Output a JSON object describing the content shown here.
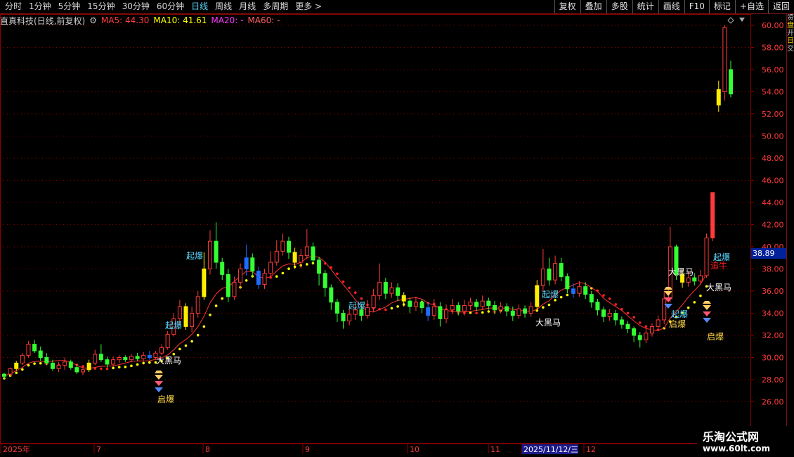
{
  "toolbar": {
    "periods": [
      "分时",
      "1分钟",
      "5分钟",
      "15分钟",
      "30分钟",
      "60分钟",
      "日线",
      "周线",
      "月线",
      "多周期",
      "更多 >"
    ],
    "active_period": "日线",
    "tools": [
      "复权",
      "叠加",
      "多股",
      "统计",
      "画线",
      "F10",
      "标记",
      "+自选",
      "返回"
    ]
  },
  "info": {
    "stock": "直真科技(日线,前复权)",
    "ma5": "MA5: 44.30",
    "ma10": "MA10: 41.61",
    "ma20": "MA20: -",
    "ma60": "MA60: -"
  },
  "y_axis": {
    "ticks": [
      "60.00",
      "58.00",
      "56.00",
      "54.00",
      "52.00",
      "50.00",
      "48.00",
      "46.00",
      "44.00",
      "42.00",
      "40.00",
      "38.00",
      "36.00",
      "34.00",
      "32.00",
      "30.00",
      "28.00",
      "26.00"
    ],
    "current_price": "38.89"
  },
  "x_axis": {
    "labels": [
      "2025年",
      "7",
      "8",
      "9",
      "10",
      "11",
      "2025/11/12/三",
      "12"
    ]
  },
  "right_edge": {
    "text_1": "资金流向资金流向",
    "tag_1": "盘",
    "text_2": "开盘涨跌幅",
    "tag_2": "日",
    "text_3": "交易"
  },
  "signals": {
    "qibao": "起爆",
    "dahei": "大黑马",
    "qibao2": "启爆",
    "zhuiniu": "追牛"
  },
  "watermark": {
    "title": "乐淘公式网",
    "url": "www.60lt.com"
  },
  "colors": {
    "up": "#ff3a3a",
    "down": "#33ff33",
    "signal_bar": "#ffee00",
    "blue_bar": "#1e6bff",
    "ma_dots": "#ffff00",
    "red_dots": "#ff2020",
    "grid": "#8b0000"
  },
  "chart_data": {
    "type": "candlestick",
    "ylim": [
      25,
      61
    ],
    "bars": [
      [
        28.3,
        28.5,
        28.0,
        28.6,
        "d"
      ],
      [
        28.5,
        29.0,
        28.3,
        29.1,
        "u"
      ],
      [
        29.0,
        29.5,
        28.8,
        29.7,
        "u"
      ],
      [
        29.5,
        30.2,
        29.3,
        30.4,
        "u"
      ],
      [
        30.2,
        31.2,
        30.0,
        31.5,
        "u"
      ],
      [
        31.2,
        30.6,
        30.4,
        31.6,
        "d"
      ],
      [
        30.6,
        30.0,
        29.7,
        31.0,
        "d"
      ],
      [
        30.0,
        29.5,
        29.3,
        30.4,
        "d"
      ],
      [
        29.5,
        29.0,
        28.8,
        29.8,
        "d"
      ],
      [
        29.0,
        29.3,
        28.7,
        29.6,
        "u"
      ],
      [
        29.3,
        29.6,
        28.9,
        30.0,
        "u"
      ],
      [
        29.6,
        29.1,
        28.9,
        29.8,
        "d"
      ],
      [
        29.1,
        28.7,
        28.5,
        29.4,
        "d"
      ],
      [
        28.7,
        28.9,
        28.4,
        29.2,
        "u"
      ],
      [
        28.9,
        29.5,
        28.7,
        29.8,
        "u"
      ],
      [
        29.5,
        30.3,
        29.3,
        30.7,
        "u"
      ],
      [
        30.3,
        29.8,
        29.6,
        31.2,
        "d"
      ],
      [
        29.8,
        29.4,
        29.1,
        30.1,
        "d"
      ],
      [
        29.4,
        29.8,
        29.2,
        30.1,
        "u"
      ],
      [
        29.8,
        30.0,
        29.5,
        30.2,
        "u"
      ],
      [
        30.0,
        29.8,
        29.6,
        30.2,
        "d"
      ],
      [
        29.8,
        30.1,
        29.6,
        30.3,
        "u"
      ],
      [
        30.1,
        29.9,
        29.7,
        30.4,
        "d"
      ],
      [
        29.9,
        30.2,
        29.7,
        30.5,
        "u"
      ],
      [
        30.2,
        30.0,
        29.8,
        30.6,
        "d"
      ],
      [
        30.0,
        30.4,
        29.8,
        30.6,
        "u"
      ],
      [
        30.4,
        30.9,
        30.2,
        31.2,
        "u"
      ],
      [
        30.9,
        32.1,
        30.7,
        32.4,
        "u"
      ],
      [
        32.1,
        33.5,
        31.9,
        34.0,
        "u"
      ],
      [
        33.5,
        34.6,
        33.0,
        35.2,
        "u"
      ],
      [
        34.6,
        32.8,
        32.5,
        34.9,
        "d"
      ],
      [
        32.8,
        34.0,
        32.3,
        34.6,
        "u"
      ],
      [
        34.0,
        35.5,
        33.6,
        36.0,
        "u"
      ],
      [
        35.5,
        38.0,
        35.2,
        39.5,
        "u"
      ],
      [
        38.0,
        40.5,
        37.5,
        41.5,
        "u"
      ],
      [
        40.5,
        38.6,
        38.0,
        42.2,
        "d"
      ],
      [
        38.6,
        37.5,
        37.0,
        39.0,
        "d"
      ],
      [
        37.5,
        35.5,
        35.0,
        38.0,
        "d"
      ],
      [
        35.5,
        36.8,
        35.2,
        37.3,
        "u"
      ],
      [
        36.8,
        38.0,
        36.3,
        38.5,
        "u"
      ],
      [
        38.0,
        39.0,
        37.4,
        40.2,
        "u"
      ],
      [
        39.0,
        37.8,
        37.3,
        39.4,
        "d"
      ],
      [
        37.8,
        36.6,
        36.2,
        38.2,
        "d"
      ],
      [
        36.6,
        37.6,
        36.2,
        38.0,
        "u"
      ],
      [
        37.6,
        38.6,
        37.2,
        39.6,
        "u"
      ],
      [
        38.6,
        39.6,
        38.3,
        40.6,
        "u"
      ],
      [
        39.6,
        40.5,
        39.2,
        41.2,
        "u"
      ],
      [
        40.5,
        39.5,
        38.9,
        40.9,
        "d"
      ],
      [
        39.5,
        38.6,
        38.0,
        39.9,
        "d"
      ],
      [
        38.6,
        39.2,
        38.1,
        39.8,
        "u"
      ],
      [
        39.2,
        40.0,
        38.9,
        41.6,
        "u"
      ],
      [
        40.0,
        38.8,
        38.4,
        40.4,
        "d"
      ],
      [
        38.8,
        37.6,
        36.5,
        39.1,
        "d"
      ],
      [
        37.6,
        36.3,
        35.5,
        37.9,
        "d"
      ],
      [
        36.3,
        35.0,
        34.3,
        36.6,
        "d"
      ],
      [
        35.0,
        34.0,
        33.2,
        35.3,
        "d"
      ],
      [
        34.0,
        33.3,
        32.6,
        34.3,
        "d"
      ],
      [
        33.3,
        33.9,
        32.9,
        34.5,
        "u"
      ],
      [
        33.9,
        34.3,
        33.4,
        34.8,
        "u"
      ],
      [
        34.3,
        33.8,
        33.3,
        34.6,
        "d"
      ],
      [
        33.8,
        34.5,
        33.5,
        35.2,
        "u"
      ],
      [
        34.5,
        35.6,
        34.1,
        36.2,
        "u"
      ],
      [
        35.6,
        36.8,
        35.2,
        38.5,
        "u"
      ],
      [
        36.8,
        35.8,
        35.3,
        37.2,
        "d"
      ],
      [
        35.8,
        36.3,
        35.4,
        36.8,
        "u"
      ],
      [
        36.3,
        35.6,
        35.1,
        36.7,
        "d"
      ],
      [
        35.6,
        35.1,
        34.6,
        35.9,
        "d"
      ],
      [
        35.1,
        34.6,
        34.0,
        35.4,
        "d"
      ],
      [
        34.6,
        35.0,
        34.2,
        35.5,
        "u"
      ],
      [
        35.0,
        34.5,
        34.0,
        35.3,
        "d"
      ],
      [
        34.5,
        33.8,
        33.3,
        35.0,
        "d"
      ],
      [
        33.8,
        34.6,
        33.4,
        35.3,
        "u"
      ],
      [
        34.6,
        33.5,
        32.8,
        35.0,
        "d"
      ],
      [
        33.5,
        34.3,
        33.1,
        34.8,
        "u"
      ],
      [
        34.3,
        34.7,
        33.9,
        35.3,
        "u"
      ],
      [
        34.7,
        34.2,
        33.8,
        35.0,
        "d"
      ],
      [
        34.2,
        34.7,
        33.8,
        35.2,
        "u"
      ],
      [
        34.7,
        35.0,
        34.3,
        35.4,
        "u"
      ],
      [
        35.0,
        34.6,
        34.2,
        35.3,
        "d"
      ],
      [
        34.6,
        35.1,
        34.3,
        35.6,
        "u"
      ],
      [
        35.1,
        34.7,
        34.3,
        35.4,
        "d"
      ],
      [
        34.7,
        34.3,
        33.9,
        35.1,
        "d"
      ],
      [
        34.3,
        34.6,
        34.0,
        35.0,
        "u"
      ],
      [
        34.6,
        34.2,
        33.7,
        34.9,
        "d"
      ],
      [
        34.2,
        33.8,
        33.3,
        34.6,
        "d"
      ],
      [
        33.8,
        34.4,
        33.5,
        34.8,
        "u"
      ],
      [
        34.4,
        34.0,
        33.6,
        34.7,
        "d"
      ],
      [
        34.0,
        34.6,
        33.7,
        35.0,
        "u"
      ],
      [
        34.6,
        36.5,
        34.3,
        37.0,
        "u"
      ],
      [
        36.5,
        38.0,
        36.0,
        39.8,
        "u"
      ],
      [
        38.0,
        37.0,
        36.5,
        39.0,
        "d"
      ],
      [
        37.0,
        38.5,
        36.6,
        39.2,
        "u"
      ],
      [
        38.5,
        37.3,
        36.9,
        39.0,
        "d"
      ],
      [
        37.3,
        36.2,
        35.8,
        37.6,
        "d"
      ],
      [
        36.2,
        35.8,
        35.4,
        36.7,
        "d"
      ],
      [
        35.8,
        36.4,
        35.5,
        36.9,
        "u"
      ],
      [
        36.4,
        35.7,
        35.3,
        36.8,
        "d"
      ],
      [
        35.7,
        35.0,
        34.5,
        36.0,
        "d"
      ],
      [
        35.0,
        34.3,
        33.8,
        35.3,
        "d"
      ],
      [
        34.3,
        33.7,
        33.2,
        34.6,
        "d"
      ],
      [
        33.7,
        34.0,
        33.3,
        34.4,
        "u"
      ],
      [
        34.0,
        33.4,
        32.9,
        34.3,
        "d"
      ],
      [
        33.4,
        33.0,
        32.6,
        33.7,
        "d"
      ],
      [
        33.0,
        32.6,
        32.2,
        33.3,
        "d"
      ],
      [
        32.6,
        32.0,
        31.4,
        32.8,
        "d"
      ],
      [
        32.0,
        31.6,
        30.9,
        32.3,
        "d"
      ],
      [
        31.6,
        32.2,
        31.3,
        32.6,
        "u"
      ],
      [
        32.2,
        32.8,
        31.9,
        33.1,
        "u"
      ],
      [
        32.8,
        33.4,
        32.5,
        33.8,
        "u"
      ],
      [
        33.4,
        35.3,
        33.0,
        36.0,
        "u"
      ],
      [
        35.3,
        40.0,
        35.0,
        41.8,
        "u"
      ],
      [
        40.0,
        37.5,
        37.0,
        40.2,
        "d"
      ],
      [
        37.5,
        36.8,
        36.3,
        38.0,
        "d"
      ],
      [
        36.8,
        37.2,
        36.4,
        37.8,
        "u"
      ],
      [
        37.2,
        36.9,
        36.5,
        37.6,
        "d"
      ],
      [
        36.9,
        37.4,
        36.6,
        37.9,
        "u"
      ],
      [
        37.4,
        40.8,
        37.2,
        41.2,
        "u"
      ],
      [
        40.8,
        44.9,
        40.5,
        44.9,
        "u"
      ],
      [
        52.8,
        54.2,
        52.2,
        55.0,
        "u"
      ],
      [
        54.0,
        59.8,
        53.2,
        60.0,
        "u"
      ],
      [
        56.0,
        53.8,
        53.5,
        56.8,
        "d"
      ]
    ]
  }
}
